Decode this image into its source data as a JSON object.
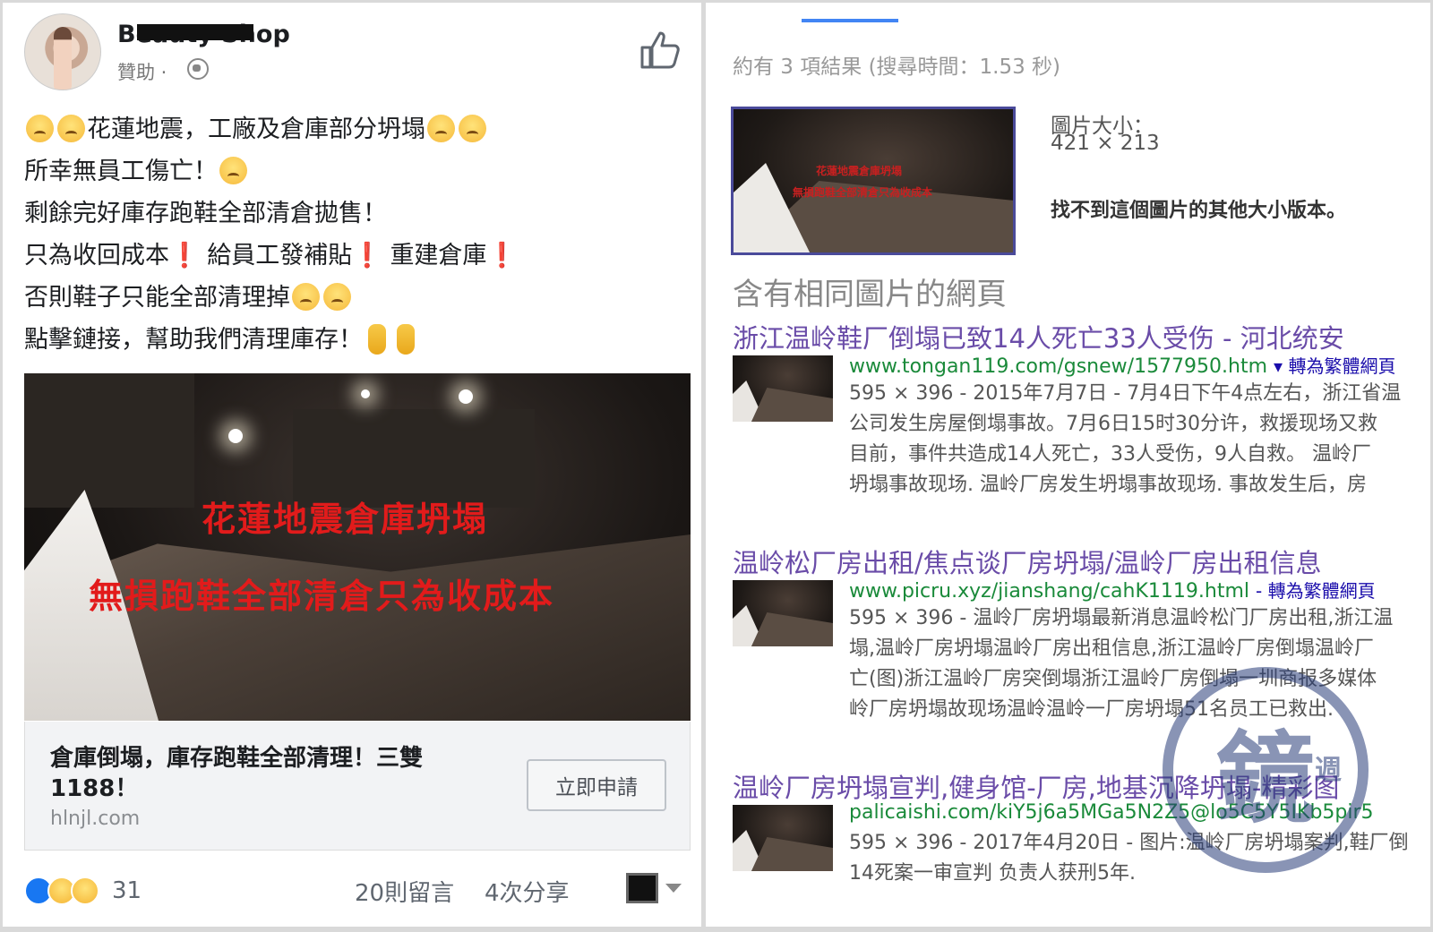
{
  "facebook_ad": {
    "page_name": "Beauty Shop",
    "sponsored_label": "贊助 ·",
    "post_lines": [
      "花蓮地震，工廠及倉庫部分坍塌",
      "所幸無員工傷亡！",
      "剩餘完好庫存跑鞋全部清倉拋售！",
      "只為收回成本",
      "給員工發補貼",
      "重建倉庫",
      "否則鞋子只能全部清理掉",
      "點擊鏈接，幫助我們清理庫存！"
    ],
    "exclamation": "❗",
    "image_overlay_line1": "花蓮地震倉庫坍塌",
    "image_overlay_line2": "無損跑鞋全部清倉只為收成本",
    "ad_headline": "倉庫倒塌，庫存跑鞋全部清理！三雙1188！",
    "ad_domain": "hlnjl.com",
    "cta_label": "立即申請",
    "reaction_count": "31",
    "comments_count": "20則留言",
    "shares_count": "4次分享"
  },
  "google_search": {
    "result_stats": "約有 3 項結果 (搜尋時間：1.53 秒)",
    "thumb_overlay_line1": "花蓮地震倉庫坍塌",
    "thumb_overlay_line2": "無損跑鞋全部清倉只為收成本",
    "image_size_label": "圖片大小：",
    "image_size_value": "421 × 213",
    "no_other_sizes": "找不到這個圖片的其他大小版本。",
    "section_heading": "含有相同圖片的網頁",
    "results": [
      {
        "title": "浙江温岭鞋厂倒塌已致14人死亡33人受伤 - 河北统安",
        "url": "www.tongan119.com/gsnew/1577950.htm",
        "translate_label": "▾ 轉為繁體網頁",
        "snippet": [
          "595 × 396 - 2015年7月7日 - 7月4日下午4点左右，浙江省温",
          "公司发生房屋倒塌事故。7月6日15时30分许，救援现场又救",
          "目前，事件共造成14人死亡，33人受伤，9人自救。 温岭厂",
          "坍塌事故现场. 温岭厂房发生坍塌事故现场. 事故发生后，房"
        ]
      },
      {
        "title": "温岭松厂房出租/焦点谈厂房坍塌/温岭厂房出租信息",
        "url": "www.picru.xyz/jianshang/cahK1119.html",
        "translate_label": "- 轉為繁體網頁",
        "snippet": [
          "595 × 396 - 温岭厂房坍塌最新消息温岭松门厂房出租,浙江温",
          "塌,温岭厂房坍塌温岭厂房出租信息,浙江温岭厂房倒塌温岭厂",
          "亡(图)浙江温岭厂房突倒塌浙江温岭厂房倒塌一圳商报多媒体",
          "岭厂房坍塌故现场温岭温岭一厂房坍塌51名员工已救出."
        ]
      },
      {
        "title": "温岭厂房坍塌宣判,健身馆-厂房,地基沉降坍塌-精彩图",
        "url": "palicaishi.com/kiY5j6a5MGa5N2Z5@lo5C5Y5IKb5pir5",
        "translate_label": "",
        "snippet": [
          "595 × 396 - 2017年4月20日 - 图片:温岭厂房坍塌案判,鞋厂倒",
          "14死案一审宣判 负责人获刑5年."
        ]
      }
    ]
  },
  "watermark": {
    "main": "鏡",
    "sub": "週"
  }
}
